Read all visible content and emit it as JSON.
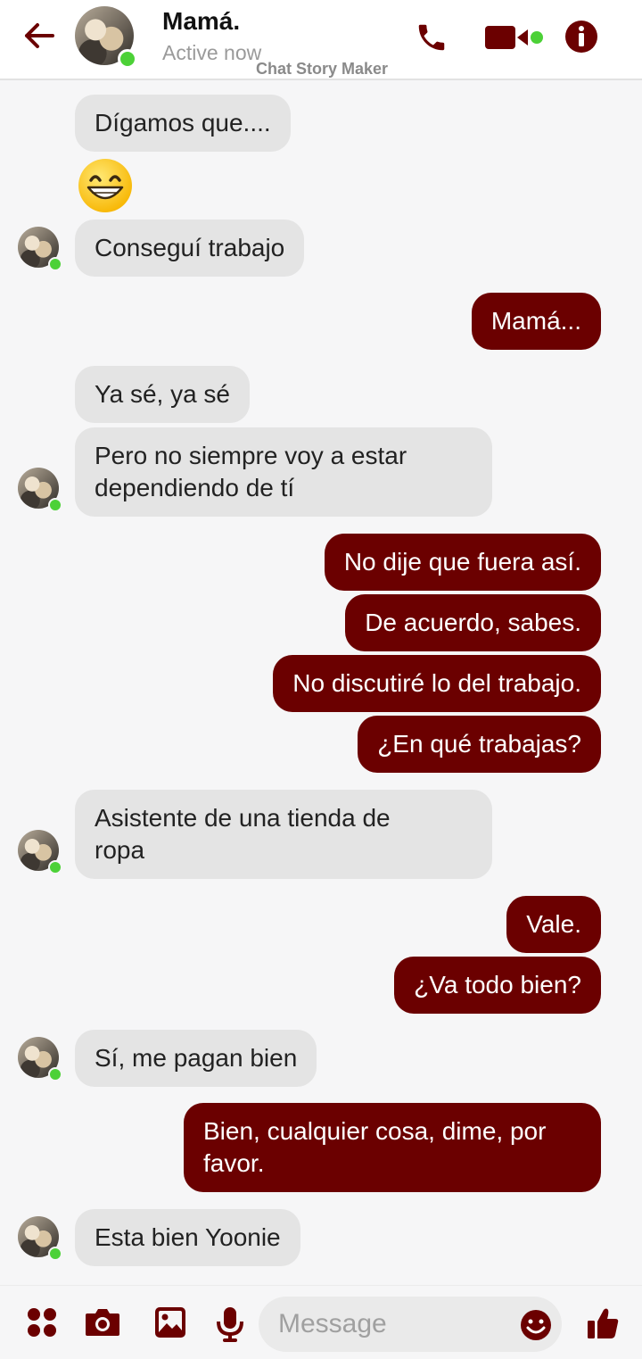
{
  "header": {
    "contact_name": "Mamá.",
    "status": "Active now",
    "watermark": "Chat Story Maker",
    "icons": [
      "back-arrow-icon",
      "phone-icon",
      "video-camera-icon",
      "info-icon"
    ]
  },
  "messages": [
    {
      "from": "contact",
      "text": "Dígamos que...."
    },
    {
      "from": "contact",
      "emoji": "grinning-face"
    },
    {
      "from": "contact",
      "text": "Conseguí trabajo"
    },
    {
      "from": "me",
      "text": "Mamá..."
    },
    {
      "from": "contact",
      "text": "Ya sé, ya sé"
    },
    {
      "from": "contact",
      "text": "Pero no siempre voy a estar\ndependiendo de tí"
    },
    {
      "from": "me",
      "text": "No dije que fuera así."
    },
    {
      "from": "me",
      "text": "De acuerdo, sabes."
    },
    {
      "from": "me",
      "text": "No discutiré lo del trabajo."
    },
    {
      "from": "me",
      "text": "¿En qué trabajas?"
    },
    {
      "from": "contact",
      "text": "Asistente de una tienda de\nropa"
    },
    {
      "from": "me",
      "text": "Vale."
    },
    {
      "from": "me",
      "text": "¿Va todo bien?"
    },
    {
      "from": "contact",
      "text": "Sí, me pagan bien"
    },
    {
      "from": "me",
      "text": "Bien, cualquier cosa, dime, por\nfavor."
    },
    {
      "from": "contact",
      "text": "Esta bien Yoonie"
    }
  ],
  "composer": {
    "placeholder": "Message",
    "icons": [
      "apps-icon",
      "camera-icon",
      "gallery-icon",
      "microphone-icon",
      "emoji-icon",
      "thumbs-up-icon"
    ]
  },
  "colors": {
    "accent": "#6b0000",
    "incoming_bubble": "#e4e4e4",
    "online": "#4cd137",
    "background": "#f6f6f7"
  }
}
